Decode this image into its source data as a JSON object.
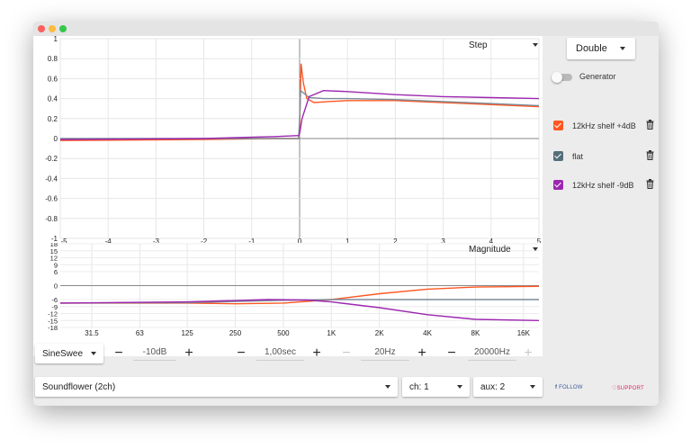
{
  "step_chart": {
    "mode_label": "Step",
    "y_ticks": [
      "1",
      "0.8",
      "0.6",
      "0.4",
      "0.2",
      "0",
      "-0.2",
      "-0.4",
      "-0.6",
      "-0.8",
      "-1"
    ],
    "x_ticks": [
      "-5",
      "-4",
      "-3",
      "-2",
      "-1",
      "0",
      "1",
      "2",
      "3",
      "4",
      "5"
    ]
  },
  "magnitude_chart": {
    "mode_label": "Magnitude",
    "y_ticks": [
      "18",
      "15",
      "12",
      "9",
      "6",
      "0",
      "-6",
      "-9",
      "-12",
      "-15",
      "-18"
    ],
    "x_ticks": [
      "31.5",
      "63",
      "125",
      "250",
      "500",
      "1K",
      "2K",
      "4K",
      "8K",
      "16K"
    ]
  },
  "chart_data": [
    {
      "type": "line",
      "title": "",
      "xlim": [
        -5,
        5
      ],
      "ylim": [
        -1,
        1
      ],
      "grid": true,
      "series": [
        {
          "name": "12kHz shelf +4dB",
          "color": "#ff5722",
          "x": [
            -5,
            -2,
            -0.5,
            -0.02,
            0,
            0.03,
            0.08,
            0.15,
            0.3,
            0.6,
            1,
            2,
            3,
            4,
            5
          ],
          "y": [
            -0.02,
            -0.01,
            0.0,
            0.0,
            0.1,
            0.75,
            0.55,
            0.4,
            0.36,
            0.37,
            0.38,
            0.38,
            0.36,
            0.34,
            0.32
          ]
        },
        {
          "name": "flat",
          "color": "#7b8c98",
          "x": [
            -5,
            -0.02,
            0,
            0.02,
            0.2,
            0.5,
            1,
            2,
            3,
            4,
            5
          ],
          "y": [
            0,
            0,
            0.2,
            0.48,
            0.41,
            0.4,
            0.4,
            0.39,
            0.37,
            0.35,
            0.33
          ]
        },
        {
          "name": "12kHz shelf -9dB",
          "color": "#9c27b0",
          "x": [
            -5,
            -2,
            -0.5,
            -0.02,
            0,
            0.05,
            0.2,
            0.5,
            1,
            2,
            3,
            4,
            5
          ],
          "y": [
            -0.01,
            0.0,
            0.02,
            0.03,
            0.05,
            0.2,
            0.42,
            0.48,
            0.47,
            0.44,
            0.42,
            0.41,
            0.4
          ]
        }
      ]
    },
    {
      "type": "line",
      "title": "",
      "xscale": "log",
      "xlim": [
        20,
        20000
      ],
      "ylim": [
        -18,
        18
      ],
      "grid": true,
      "series": [
        {
          "name": "12kHz shelf +4dB",
          "color": "#ff5722",
          "x": [
            20,
            125,
            250,
            500,
            1000,
            2000,
            4000,
            8000,
            20000
          ],
          "y": [
            -7.5,
            -7.5,
            -7.8,
            -7.5,
            -6,
            -3.5,
            -1.5,
            -0.6,
            -0.3
          ]
        },
        {
          "name": "flat",
          "color": "#7b8c98",
          "x": [
            20,
            125,
            500,
            1000,
            2000,
            4000,
            8000,
            20000
          ],
          "y": [
            -7.5,
            -7.3,
            -6.3,
            -6,
            -6,
            -6,
            -6,
            -6
          ]
        },
        {
          "name": "12kHz shelf -9dB",
          "color": "#9c27b0",
          "x": [
            20,
            125,
            400,
            700,
            1000,
            2000,
            4000,
            8000,
            20000
          ],
          "y": [
            -7.5,
            -7,
            -6,
            -6.2,
            -7,
            -9.5,
            -12.5,
            -14.5,
            -15
          ]
        }
      ]
    }
  ],
  "sidebar": {
    "mode_button": "Double",
    "generator_label": "Generator",
    "filters": [
      {
        "label": "12kHz shelf +4dB",
        "color": "#ff5722"
      },
      {
        "label": "flat",
        "color": "#546e7a"
      },
      {
        "label": "12kHz shelf -9dB",
        "color": "#9c27b0"
      }
    ]
  },
  "controls": {
    "signal_select": "SineSwee",
    "level_value": "-10dB",
    "duration_value": "1,00sec",
    "freq_start_value": "20Hz",
    "freq_end_value": "20000Hz",
    "minus": "−",
    "plus": "+"
  },
  "bottom": {
    "device_select": "Soundflower (2ch)",
    "channel_select": "ch: 1",
    "aux_select": "aux: 2",
    "follow_label": "FOLLOW",
    "support_label": "SUPPORT"
  },
  "colors": {
    "accent_orange": "#ff5722",
    "accent_gray": "#7b8c98",
    "accent_purple": "#9c27b0",
    "follow": "#3b5998",
    "support": "#e91e63"
  }
}
